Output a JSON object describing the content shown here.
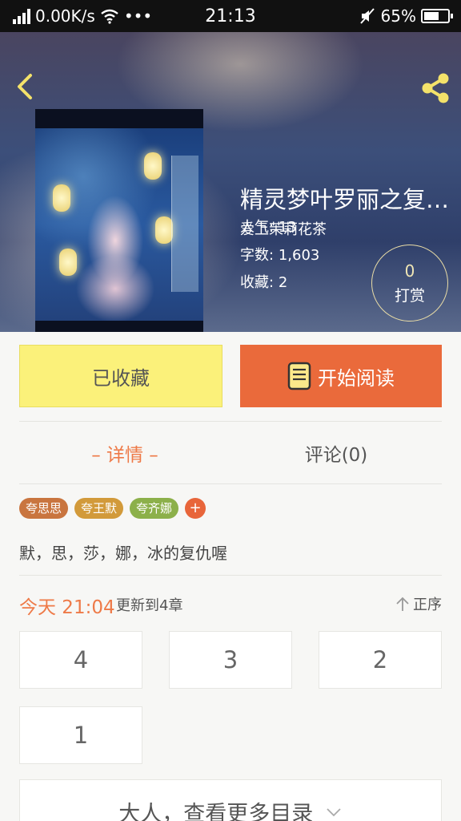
{
  "status_bar": {
    "speed": "0.00K/s",
    "more": "•••",
    "time": "21:13",
    "battery": "65%",
    "battery_level": 0.65
  },
  "book": {
    "title": "精灵梦叶罗丽之复…",
    "author": "爱上茉莉花茶",
    "popularity_label": "人气:",
    "popularity": "13",
    "words_label": "字数:",
    "words": "1,603",
    "favorites_label": "收藏:",
    "favorites": "2"
  },
  "reward": {
    "count": "0",
    "label": "打赏"
  },
  "actions": {
    "favorited_label": "已收藏",
    "read_label": "开始阅读"
  },
  "tabs": {
    "detail": "– 详情 –",
    "comments": "评论(0)"
  },
  "tags": [
    {
      "label": "夸思思",
      "color": "#c9753f"
    },
    {
      "label": "夸王默",
      "color": "#d29a3a"
    },
    {
      "label": "夸齐娜",
      "color": "#8cb04a"
    }
  ],
  "tag_add": "+",
  "description": "默，思，莎，娜，冰的复仇喔",
  "update": {
    "time": "今天 21:04",
    "text": "更新到4章",
    "sort_label": "正序"
  },
  "chapters": [
    "4",
    "3",
    "2",
    "1"
  ],
  "more_catalog": "大人，查看更多目录",
  "colors": {
    "accent": "#ea6a3b",
    "favorite_bg": "#fbf17a",
    "tab_active": "#ee7a48"
  }
}
